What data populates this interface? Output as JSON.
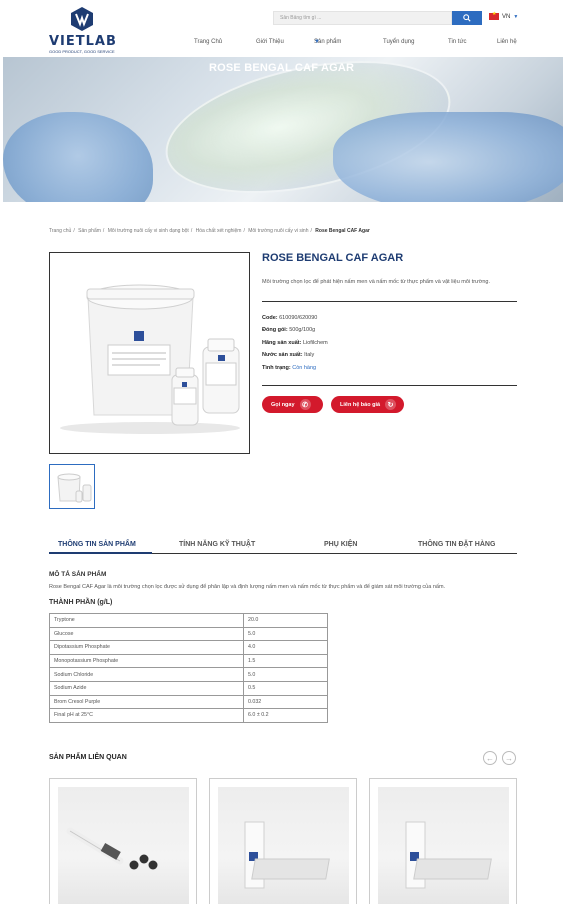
{
  "header": {
    "logo_text": "VIETLAB",
    "logo_tagline": "GOOD PRODUCT, GOOD SERVICE",
    "search_placeholder": "Sản Bảng tìm gì ...",
    "language": "VN"
  },
  "nav": {
    "items": [
      "Trang Chủ",
      "Giới Thiệu",
      "Sản phẩm",
      "Tuyển dụng",
      "Tin tức",
      "Liên hệ"
    ]
  },
  "banner": {
    "title": "ROSE BENGAL CAF AGAR"
  },
  "breadcrumb": {
    "items": [
      "Trang chủ",
      "Sản phẩm",
      "Môi trường nuôi cấy vi sinh dạng bột",
      "Hóa chất xét nghiệm",
      "Môi trường nuôi cấy vi sinh"
    ],
    "current": "Rose Bengal CAF Agar"
  },
  "product": {
    "title": "ROSE BENGAL CAF AGAR",
    "description": "Môi trường chọn lọc để phát hiện nấm men và nấm mốc từ thực phẩm và vật liệu môi trường.",
    "specs": [
      {
        "label": "Code:",
        "value": "610090/620090"
      },
      {
        "label": "Đóng gói:",
        "value": "500g/100g"
      },
      {
        "label": "Hãng sản xuất:",
        "value": "Liofilchem"
      },
      {
        "label": "Nước sản xuất:",
        "value": "Italy"
      },
      {
        "label": "Tình trạng:",
        "value": "Còn hàng"
      }
    ],
    "call_button": "Gọi ngay",
    "quote_button": "Liên hệ báo giá"
  },
  "tabs": [
    "THÔNG TIN SẢN PHẨM",
    "TÍNH NĂNG KỸ THUẬT",
    "PHỤ KIỆN",
    "THÔNG TIN ĐẶT HÀNG"
  ],
  "content": {
    "desc_heading": "MÔ TẢ SẢN PHẨM",
    "desc_text": "Rose Bengal CAF Agar là môi trường chọn lọc được sử dụng để phân lập và định lượng nấm men và nấm mốc từ thực phẩm và để giám sát môi trường của nấm.",
    "comp_heading": "THÀNH PHẦN (g/L)",
    "composition": [
      [
        "Tryptone",
        "20.0"
      ],
      [
        "Glucose",
        "5.0"
      ],
      [
        "Dipotassium Phosphate",
        "4.0"
      ],
      [
        "Monopotassium Phosphate",
        "1.5"
      ],
      [
        "Sodium Chloride",
        "5.0"
      ],
      [
        "Sodium Azide",
        "0.5"
      ],
      [
        "Brom Cresol Purple",
        "0.032"
      ],
      [
        "Final pH at 25°C",
        "6.0 ± 0.2"
      ]
    ]
  },
  "related": {
    "title": "SẢN PHẨM LIÊN QUAN"
  },
  "colors": {
    "brand": "#1e3c72",
    "accent": "#2d6cc0",
    "cta": "#d3192c"
  }
}
